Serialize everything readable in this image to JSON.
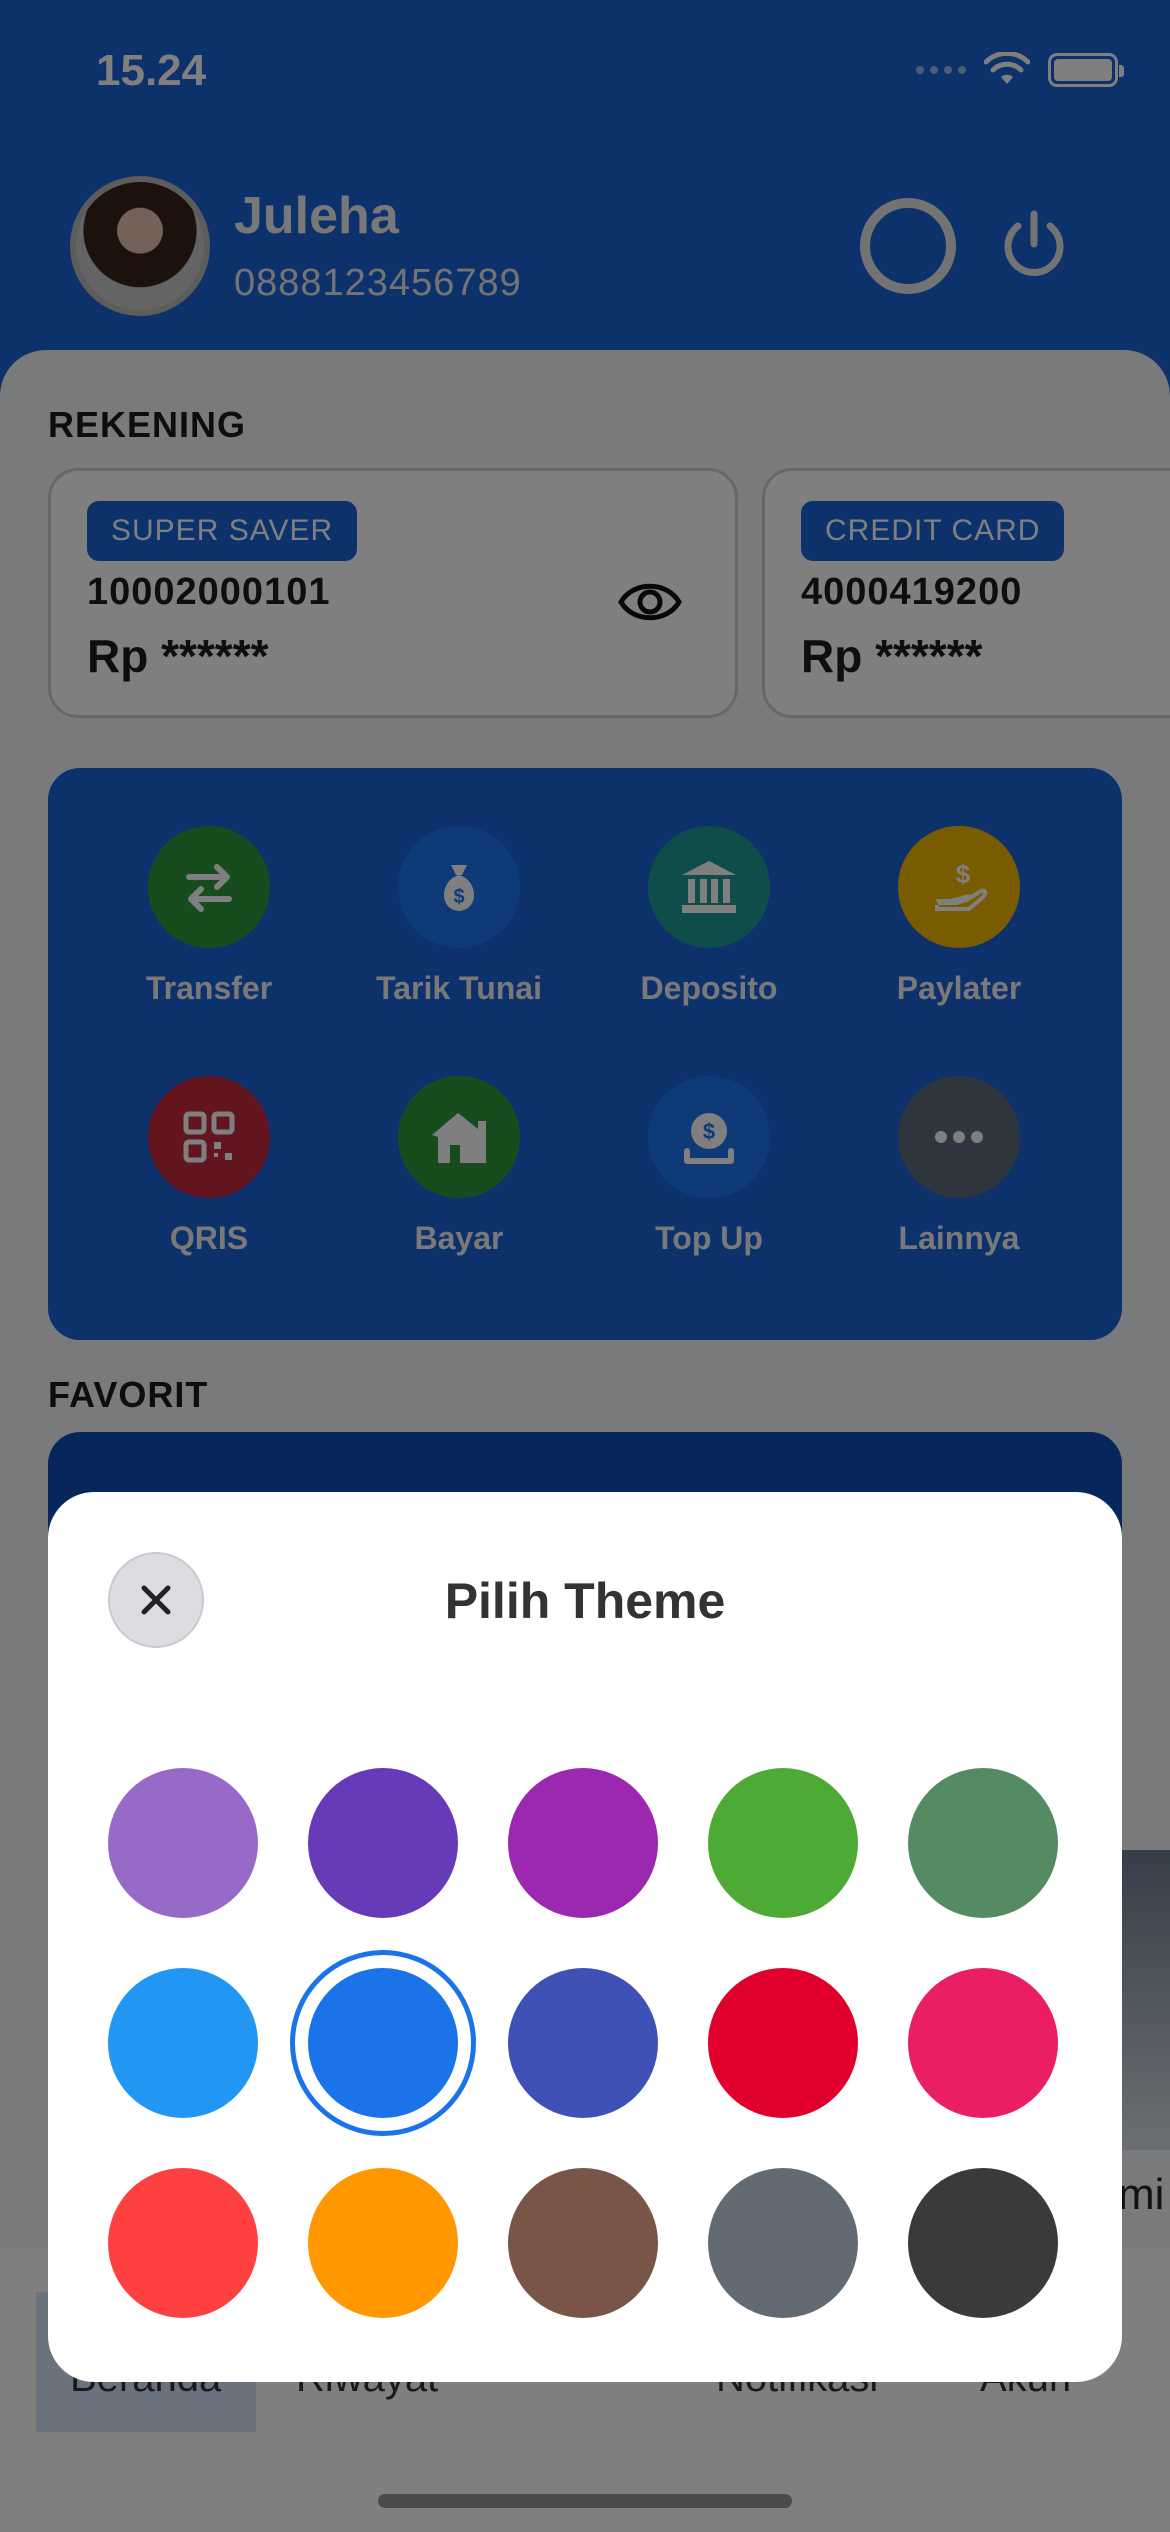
{
  "status_bar": {
    "time": "15.24"
  },
  "user": {
    "name": "Juleha",
    "phone": "0888123456789"
  },
  "rekening": {
    "title": "REKENING",
    "accounts": [
      {
        "tag": "SUPER SAVER",
        "number": "10002000101",
        "balance": "Rp ******"
      },
      {
        "tag": "CREDIT CARD",
        "number": "4000419200",
        "balance": "Rp ******"
      }
    ]
  },
  "menu": [
    {
      "label": "Transfer",
      "icon": "transfer-arrows-icon",
      "color": "#2e9b3c"
    },
    {
      "label": "Tarik Tunai",
      "icon": "money-bag-icon",
      "color": "#1e74f0"
    },
    {
      "label": "Deposito",
      "icon": "bank-icon",
      "color": "#1f9a97"
    },
    {
      "label": "Paylater",
      "icon": "hand-coin-icon",
      "color": "#f5b800"
    },
    {
      "label": "QRIS",
      "icon": "qr-code-icon",
      "color": "#c62a3f"
    },
    {
      "label": "Bayar",
      "icon": "house-bill-icon",
      "color": "#2e9b3c"
    },
    {
      "label": "Top Up",
      "icon": "wallet-coin-icon",
      "color": "#1e74f0"
    },
    {
      "label": "Lainnya",
      "icon": "more-dots-icon",
      "color": "#5c6a7a"
    }
  ],
  "favorit": {
    "title": "FAVORIT",
    "partial_text": "mi"
  },
  "bottom_nav": [
    "Beranda",
    "Riwayat",
    "Notifikasi",
    "Akun"
  ],
  "theme_modal": {
    "title": "Pilih Theme",
    "selected_index": 6,
    "colors": [
      "#9769c9",
      "#673ab7",
      "#9c27b0",
      "#4caa35",
      "#558b63",
      "#2196f3",
      "#1a73e8",
      "#3f51b5",
      "#e1002d",
      "#e91e63",
      "#ff4040",
      "#ff9800",
      "#795548",
      "#626b73",
      "#3a3a3a"
    ]
  }
}
